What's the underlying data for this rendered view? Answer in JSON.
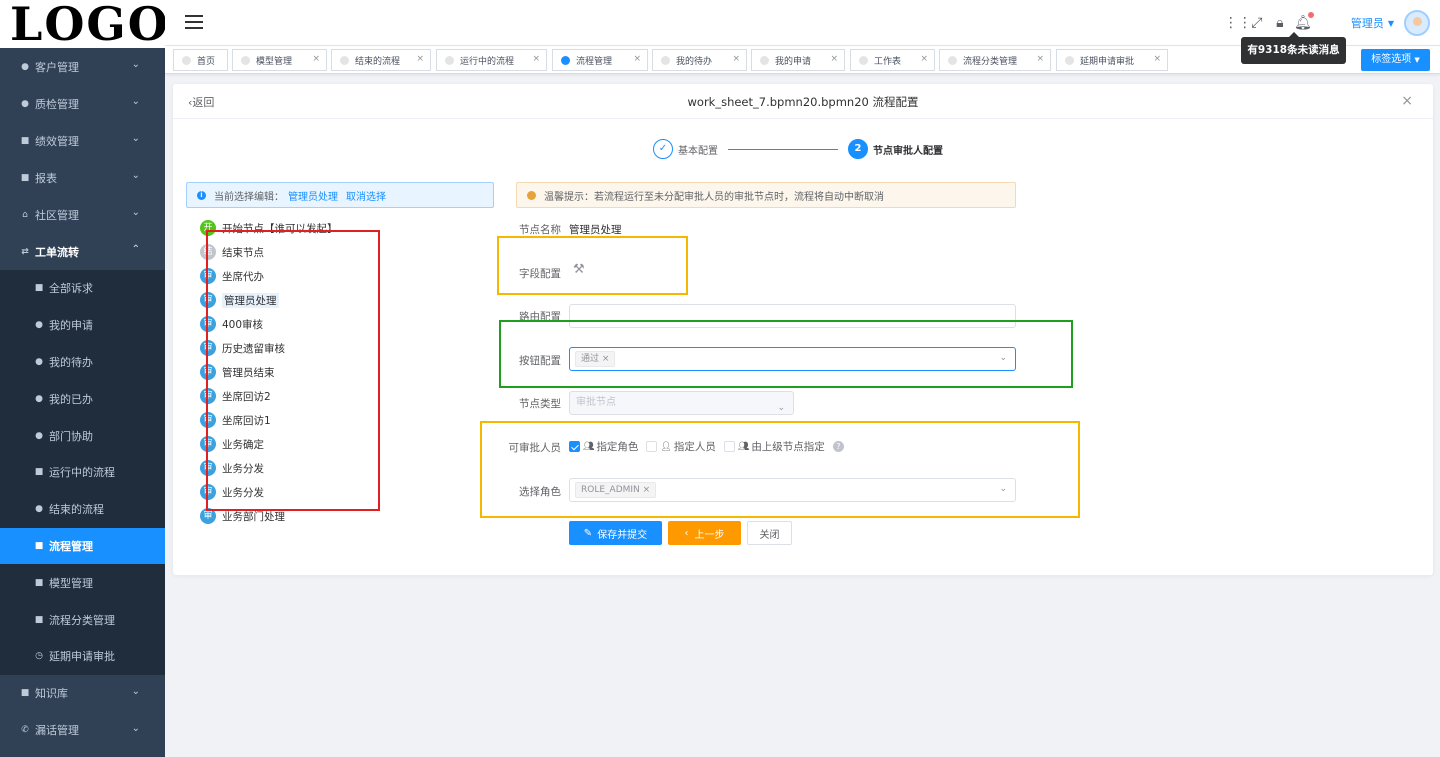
{
  "logo": "LOGO",
  "sidebar": {
    "items": [
      {
        "label": "客户管理",
        "icon": "user-group-icon"
      },
      {
        "label": "质检管理",
        "icon": "info-icon"
      },
      {
        "label": "绩效管理",
        "icon": "chart-icon"
      },
      {
        "label": "报表",
        "icon": "report-icon"
      },
      {
        "label": "社区管理",
        "icon": "home-icon"
      },
      {
        "label": "工单流转",
        "icon": "flow-icon"
      }
    ],
    "sub_items": [
      "全部诉求",
      "我的申请",
      "我的待办",
      "我的已办",
      "部门协助",
      "运行中的流程",
      "结束的流程",
      "流程管理",
      "模型管理",
      "流程分类管理",
      "延期申请审批"
    ],
    "bottom_items": [
      {
        "label": "知识库",
        "icon": "book-icon"
      },
      {
        "label": "漏话管理",
        "icon": "phone-icon"
      }
    ]
  },
  "topbar": {
    "user": "管理员",
    "tooltip": "有9318条未读消息"
  },
  "tabs": [
    "首页",
    "模型管理",
    "结束的流程",
    "运行中的流程",
    "流程管理",
    "我的待办",
    "我的申请",
    "工作表",
    "流程分类管理",
    "延期申请审批"
  ],
  "tag_options": "标签选项",
  "page": {
    "back": "返回",
    "title": "work_sheet_7.bpmn20.bpmn20 流程配置",
    "steps": [
      "基本配置",
      "节点审批人配置"
    ],
    "step2_num": "2",
    "info_prefix": "当前选择编辑：",
    "info_node": "管理员处理",
    "info_cancel": "取消选择",
    "warning": "温馨提示：若流程运行至未分配审批人员的审批节点时，流程将自动中断取消"
  },
  "tree": [
    {
      "badge": "开",
      "label": "开始节点【谁可以发起】"
    },
    {
      "badge": "结",
      "label": "结束节点"
    },
    {
      "badge": "审",
      "label": "坐席代办"
    },
    {
      "badge": "审",
      "label": "管理员处理"
    },
    {
      "badge": "审",
      "label": "400审核"
    },
    {
      "badge": "审",
      "label": "历史遗留审核"
    },
    {
      "badge": "审",
      "label": "管理员结束"
    },
    {
      "badge": "审",
      "label": "坐席回访2"
    },
    {
      "badge": "审",
      "label": "坐席回访1"
    },
    {
      "badge": "审",
      "label": "业务确定"
    },
    {
      "badge": "审",
      "label": "业务分发"
    },
    {
      "badge": "审",
      "label": "业务分发"
    },
    {
      "badge": "审",
      "label": "业务部门处理"
    }
  ],
  "form": {
    "node_name_label": "节点名称",
    "node_name_value": "管理员处理",
    "field_config_label": "字段配置",
    "route_label": "路由配置",
    "button_label": "按钮配置",
    "button_tag": "通过",
    "node_type_label": "节点类型",
    "node_type_value": "审批节点",
    "approver_label": "可审批人员",
    "opt_role": "指定角色",
    "opt_user": "指定人员",
    "opt_parent": "由上级节点指定",
    "role_label": "选择角色",
    "role_tag": "ROLE_ADMIN",
    "btn_save": "保存并提交",
    "btn_prev": "上一步",
    "btn_close": "关闭"
  }
}
